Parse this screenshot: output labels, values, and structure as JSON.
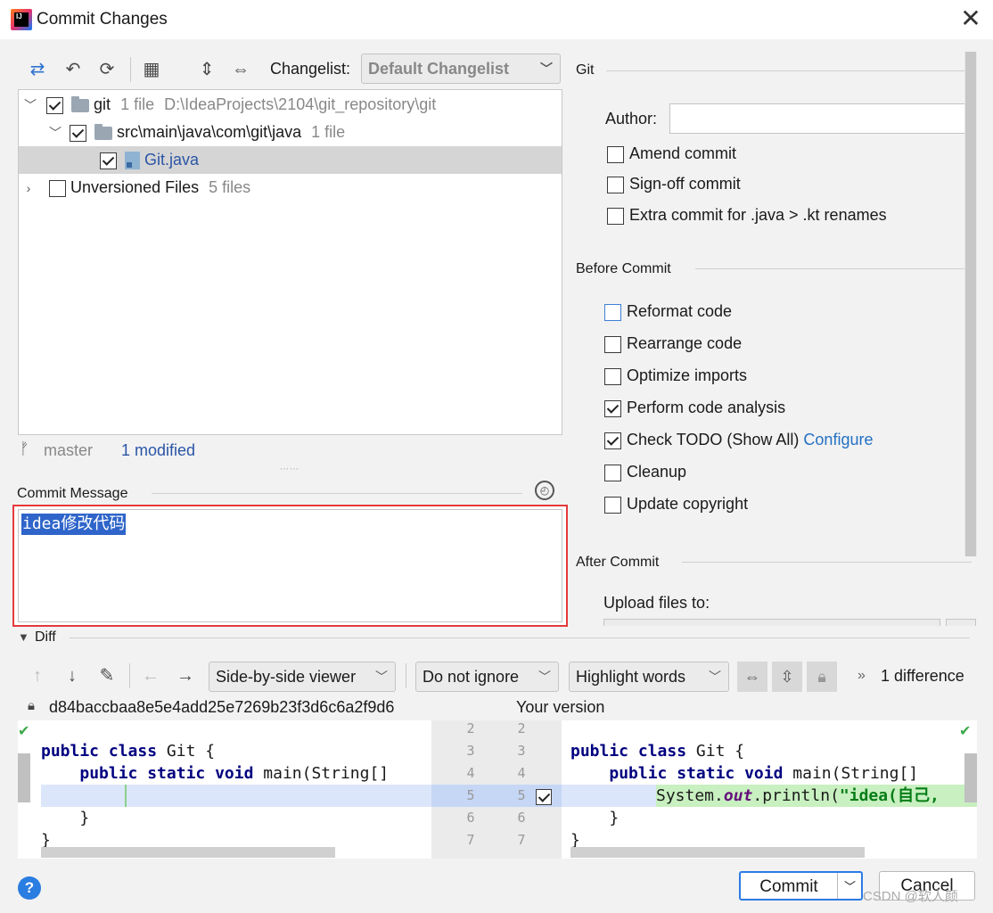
{
  "window": {
    "title": "Commit Changes"
  },
  "toolbar": {
    "changelist_label": "Changelist:",
    "changelist_value": "Default Changelist"
  },
  "tree": {
    "root": {
      "name": "git",
      "count": "1 file",
      "path": "D:\\IdeaProjects\\2104\\git_repository\\git"
    },
    "folder": {
      "name": "src\\main\\java\\com\\git\\java",
      "count": "1 file"
    },
    "file": {
      "name": "Git.java"
    },
    "unversioned": {
      "name": "Unversioned Files",
      "count": "5 files"
    }
  },
  "status": {
    "branch": "master",
    "modified": "1 modified"
  },
  "commit_message": {
    "label": "Commit Message",
    "text": "idea修改代码"
  },
  "git_section": {
    "title": "Git",
    "author_label": "Author:",
    "author_value": "",
    "amend": "Amend commit",
    "signoff": "Sign-off commit",
    "extra": "Extra commit for .java > .kt renames"
  },
  "before_commit": {
    "title": "Before Commit",
    "reformat": "Reformat code",
    "rearrange": "Rearrange code",
    "optimize": "Optimize imports",
    "analysis": "Perform code analysis",
    "todo": "Check TODO (Show All)",
    "configure": "Configure",
    "cleanup": "Cleanup",
    "copyright": "Update copyright"
  },
  "after_commit": {
    "title": "After Commit",
    "upload": "Upload files to:"
  },
  "diff": {
    "title": "Diff",
    "viewer": "Side-by-side viewer",
    "ignore": "Do not ignore",
    "highlight": "Highlight words",
    "differences": "1 difference",
    "left_hash": "d84baccbaa8e5e4add25e7269b23f3d6c6a2f9d6",
    "right_title": "Your version",
    "left_lines": [
      "2",
      "3",
      "4",
      "5",
      "6",
      "7"
    ],
    "right_lines": [
      "2",
      "3",
      "4",
      "5",
      "6",
      "7"
    ],
    "code_class": "public class Git {",
    "code_main": "    public static void main(String[]",
    "code_print_a": "System.",
    "code_print_b": "out",
    "code_print_c": ".println(",
    "code_print_d": "\"idea(自己,",
    "code_close_inner": "    }",
    "code_close_outer": "}"
  },
  "buttons": {
    "commit": "Commit",
    "cancel": "Cancel"
  },
  "watermark": "CSDN @软人颜",
  "colors": {
    "accent": "#2c7be5",
    "highlight_red": "#e5393b",
    "selection": "#2f65ca"
  }
}
